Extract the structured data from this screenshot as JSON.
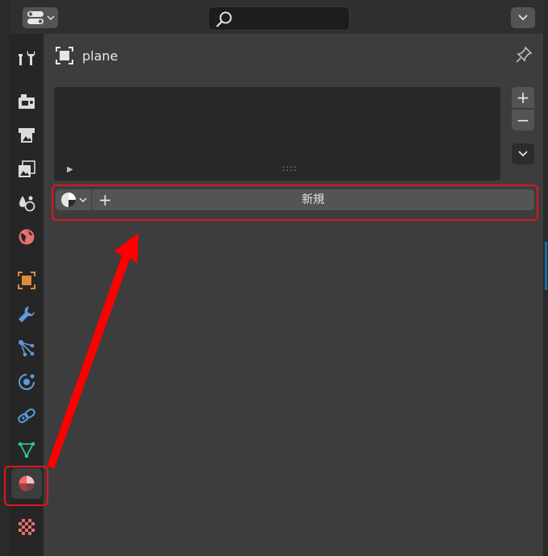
{
  "header": {
    "editor_type_icon": "editor-type-icon",
    "search": {
      "value": "",
      "placeholder": ""
    },
    "options_icon": "chevron-down-icon"
  },
  "tabs": [
    {
      "id": "tool",
      "icon": "tool-icon"
    },
    {
      "id": "render",
      "icon": "render-icon"
    },
    {
      "id": "output",
      "icon": "output-icon"
    },
    {
      "id": "view-layer",
      "icon": "view-layer-icon"
    },
    {
      "id": "scene",
      "icon": "scene-icon"
    },
    {
      "id": "world",
      "icon": "world-icon"
    },
    {
      "id": "object",
      "icon": "object-icon"
    },
    {
      "id": "modifiers",
      "icon": "wrench-icon"
    },
    {
      "id": "particles",
      "icon": "particles-icon"
    },
    {
      "id": "physics",
      "icon": "physics-icon"
    },
    {
      "id": "constraints",
      "icon": "constraint-icon"
    },
    {
      "id": "data",
      "icon": "mesh-data-icon"
    },
    {
      "id": "material",
      "icon": "material-icon",
      "active": true
    },
    {
      "id": "texture",
      "icon": "texture-icon"
    }
  ],
  "context": {
    "object_name": "plane",
    "pin_icon": "pin-icon"
  },
  "material_slots": {
    "add_label": "+",
    "remove_label": "−",
    "expand_glyph": "▶",
    "grip_glyph": "::::"
  },
  "material_row": {
    "new_plus": "+",
    "new_label": "新規"
  },
  "colors": {
    "highlight": "#e0161b",
    "material_tab": "#e86e6e",
    "object_tab": "#e08a3c",
    "modifier_tab": "#5d9be0"
  }
}
